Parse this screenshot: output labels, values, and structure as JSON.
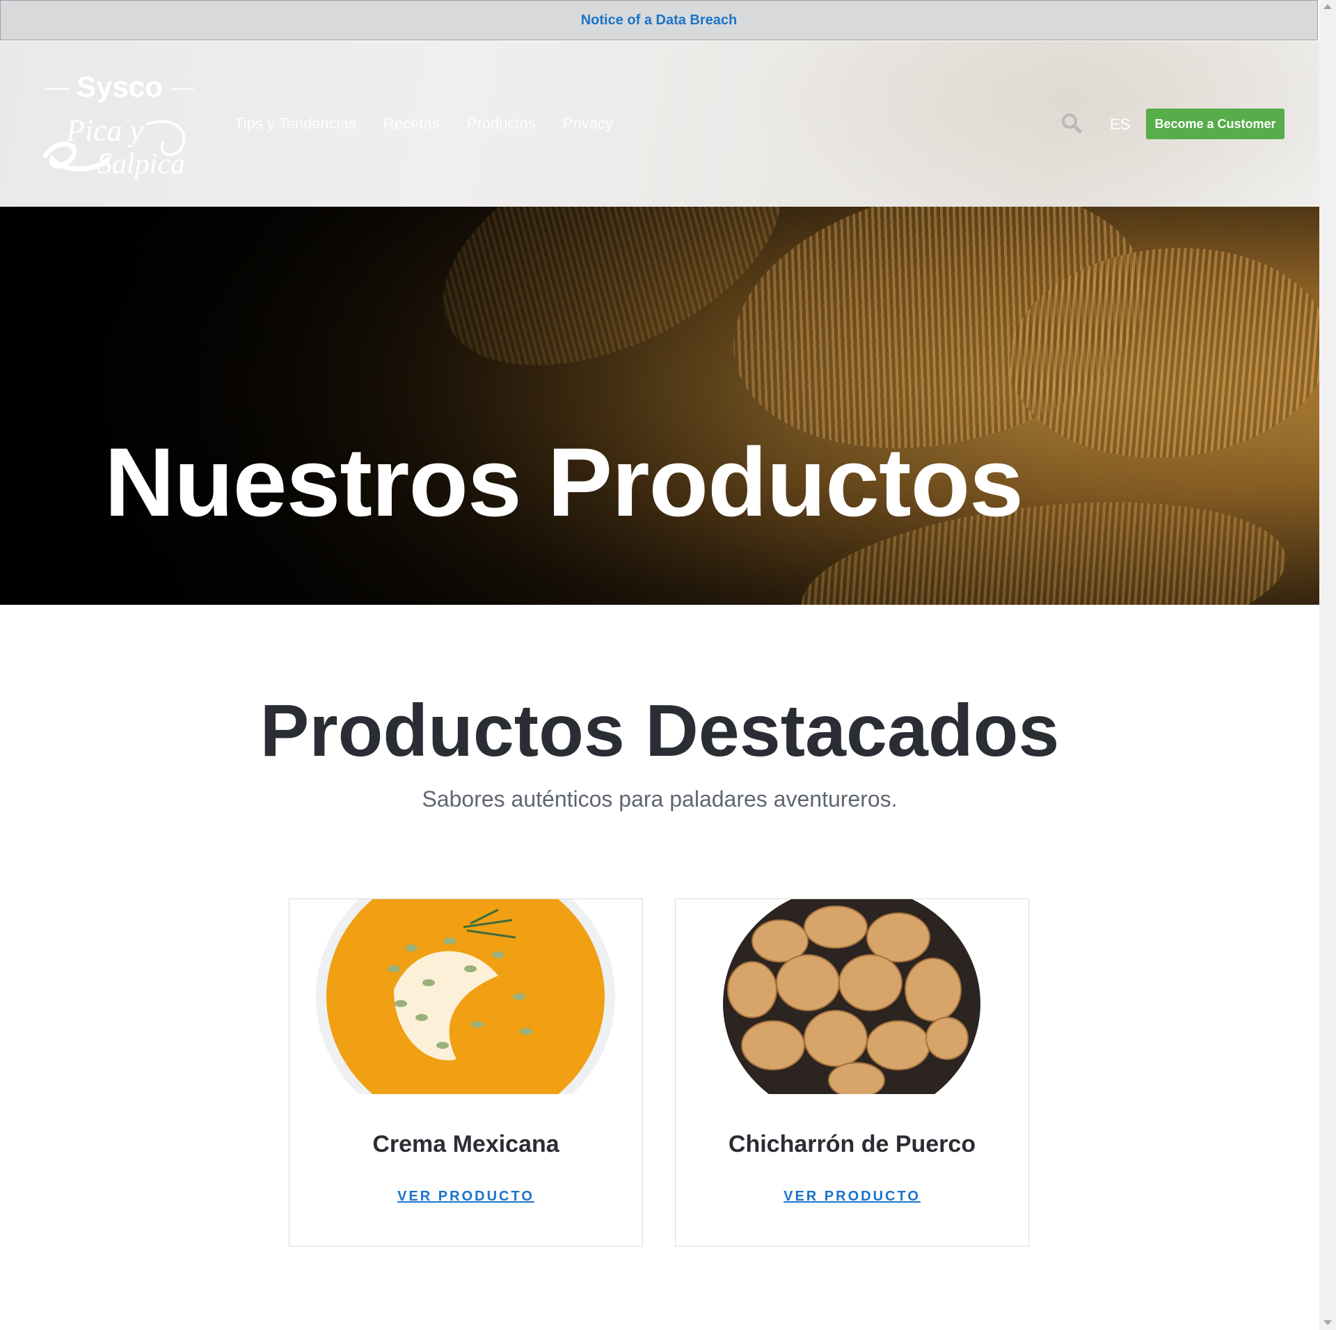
{
  "notice": {
    "link_text": "Notice of a Data Breach"
  },
  "header": {
    "logo_text": {
      "brand": "Sysco",
      "line1": "Pica y",
      "line2": "Salpica"
    },
    "nav": [
      {
        "label": "Tips y Tendencias"
      },
      {
        "label": "Recetas"
      },
      {
        "label": "Productos"
      },
      {
        "label": "Privacy"
      }
    ],
    "search_icon": "search-icon",
    "language": "ES",
    "cta_label": "Become a Customer",
    "cta_color": "#56ad4a"
  },
  "hero": {
    "title": "Nuestros Productos"
  },
  "featured": {
    "title": "Productos Destacados",
    "subtitle": "Sabores auténticos para paladares aventureros.",
    "products": [
      {
        "name": "Crema Mexicana",
        "link": "VER PRODUCTO"
      },
      {
        "name": "Chicharrón de Puerco",
        "link": "VER PRODUCTO"
      }
    ]
  },
  "colors": {
    "link": "#1a73c9",
    "heading": "#2a2d33"
  }
}
